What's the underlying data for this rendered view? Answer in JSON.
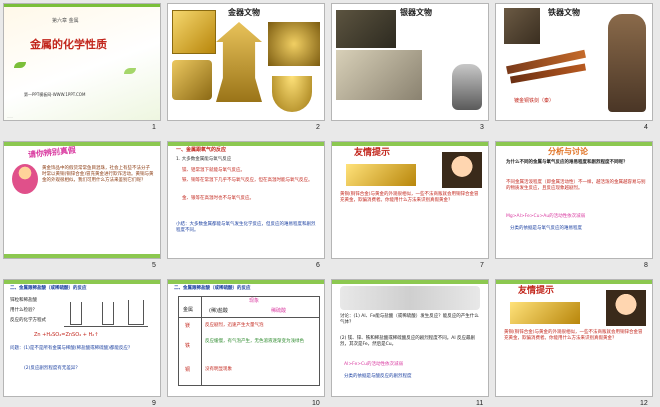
{
  "slides": [
    {
      "number": "1",
      "chapter": "第六章 金属",
      "title": "金属的化学性质",
      "site": "第一PPT模板网-WWW.1PPT.COM"
    },
    {
      "number": "2",
      "label": "金器文物"
    },
    {
      "number": "3",
      "label": "银器文物"
    },
    {
      "number": "4",
      "label": "铁器文物",
      "caption": "镀金铜铁剑（秦）"
    },
    {
      "number": "5",
      "heading": "请你辨别真假",
      "body": "黄金饰品中的假货常常鱼目混珠，社会上有些不法分子时常以黄铜(铜锌合金)冒充黄金进行欺诈活动。黄铜与黄金的外观很相似，我们可用什么方法来鉴别它们呢？"
    },
    {
      "number": "6",
      "heading": "一、金属跟氧气的反应",
      "sub": "1. 大多数金属能与氧气反应",
      "l1": "镁、铝常温下就能与氧气反应。",
      "l2": "铁、铜等在常温下几乎不与氧气反应，但在高温时能与氧气反应。",
      "l3": "金、银等在高温时也不与氧气反应。",
      "summary": "小结：大多数金属都能与氧气发生化学反应，但反应的难易程度和剧烈程度不同。"
    },
    {
      "number": "7",
      "heading": "友情提示",
      "body": "黄铜(铜锌合金)与黄金的外观很相似，一些不法商贩就会用铜锌合金冒充黄金，欺骗消费者。你能用什么方法来识别真假黄金？"
    },
    {
      "number": "8",
      "heading": "分析与讨论",
      "q": "为什么不同的金属与氧气反应的难易程度和剧烈程度不同呢？",
      "p1": "不同金属活泼程度（即金属活动性）不一样，越活泼的金属越容易与别的物质发生反应，且反应现象越剧烈。",
      "p2": "Mg>Al>Fe>Cu>Au的活动性依次减弱",
      "p3": "分类的依据是与氧气反应的难易程度"
    },
    {
      "number": "9",
      "heading": "二、金属跟稀盐酸（或稀硫酸）的反应",
      "l1": "锌粒和稀盐酸",
      "l2": "用什么检验？",
      "l3": "反应的化学方程式",
      "eq": "Zn +H₂SO₄=ZnSO₄ + H₂↑",
      "q1": "问题：(1)是不是所有金属与稀酸(稀盐酸或稀硫酸)都能反应？",
      "q2": "(2)反应剧烈程度有无差异？"
    },
    {
      "number": "10",
      "heading": "二、金属跟稀盐酸（或稀硫酸）的反应",
      "col0": "金属",
      "col1": "现象",
      "col2": "(稀)盐酸",
      "col3": "稀硫酸",
      "r1k": "镁",
      "r1": "反应剧烈，迅速产生大量气泡",
      "r2k": "铁",
      "r2": "反应缓慢，有气泡产生，无色溶液逐渐变为浅绿色",
      "r3k": "铜",
      "r3": "没有明显现象"
    },
    {
      "number": "11",
      "d1": "讨论：(1) Al、Fe能与盐酸（或稀硫酸）发生反应？能反应的产生什么气体？",
      "d2": "(2) 镁、锌、铁和稀盐酸或稀硫酸反应的剧烈程度不同。Al 反应最剧烈，其次是Fe，然后是Cu。",
      "d3": "Al>Fe>Cu的活动性依次减弱",
      "d4": "分类的依据是与酸反应的剧烈程度"
    },
    {
      "number": "12",
      "heading": "友情提示",
      "body": "黄铜(铜锌合金)与黄金的外观很相似，一些不法商贩就会用铜锌合金冒充黄金，欺骗消费者。你能用什么方法来识别真假黄金？"
    }
  ]
}
